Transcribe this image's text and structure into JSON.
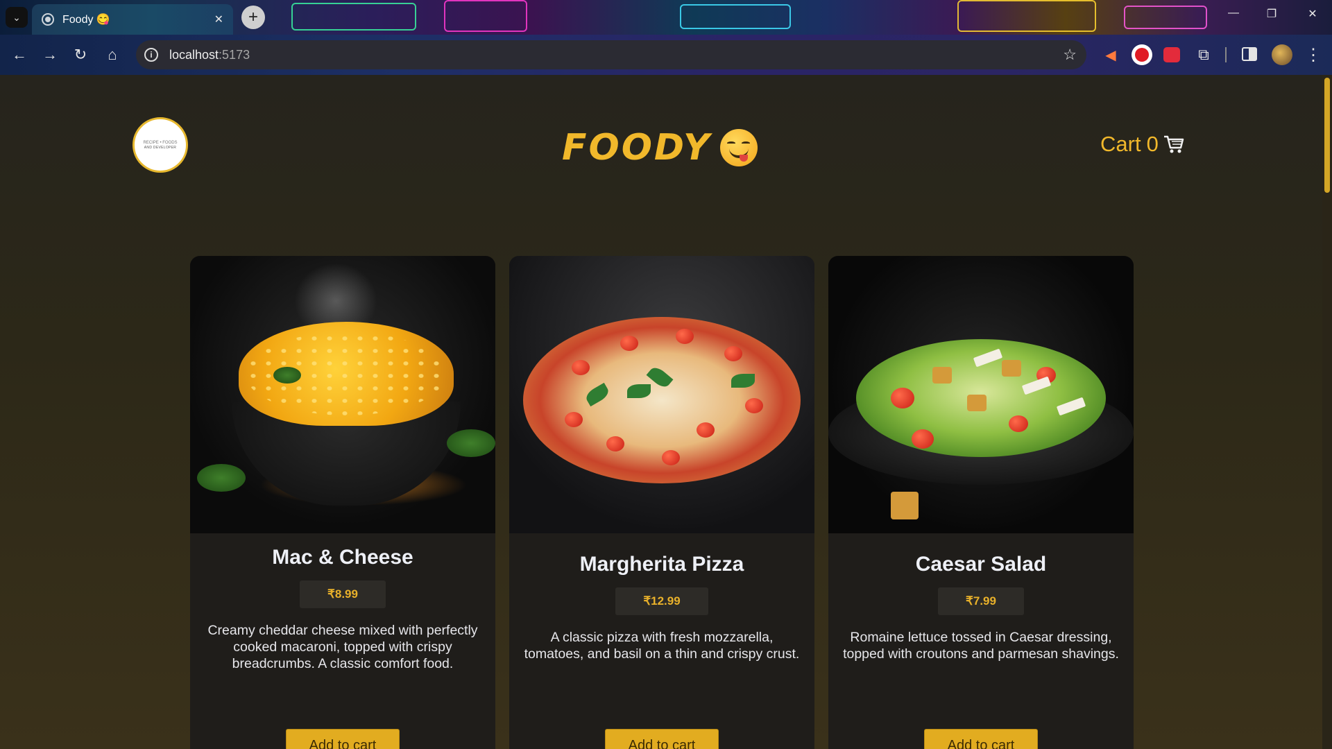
{
  "browser": {
    "tab_title": "Foody 😋",
    "tab_close": "✕",
    "new_tab": "+",
    "url_host": "localhost",
    "url_port": ":5173",
    "win_min": "—",
    "win_restore": "❐",
    "win_close": "✕"
  },
  "header": {
    "logo_line1": "RECIPE • FOODS",
    "logo_line2": "AND DEVELOPER",
    "brand": "FOODY",
    "cart_label": "Cart",
    "cart_count": "0"
  },
  "products": [
    {
      "name": "Mac & Cheese",
      "price": "₹8.99",
      "description": "Creamy cheddar cheese mixed with perfectly cooked macaroni, topped with crispy breadcrumbs. A classic comfort food.",
      "button": "Add to cart"
    },
    {
      "name": "Margherita Pizza",
      "price": "₹12.99",
      "description": "A classic pizza with fresh mozzarella, tomatoes, and basil on a thin and crispy crust.",
      "button": "Add to cart"
    },
    {
      "name": "Caesar Salad",
      "price": "₹7.99",
      "description": "Romaine lettuce tossed in Caesar dressing, topped with croutons and parmesan shavings.",
      "button": "Add to cart"
    }
  ],
  "colors": {
    "accent": "#e2ac20",
    "brand": "#f1b82b",
    "card_bg": "#1f1d1a",
    "page_bg": "#2a2519"
  }
}
